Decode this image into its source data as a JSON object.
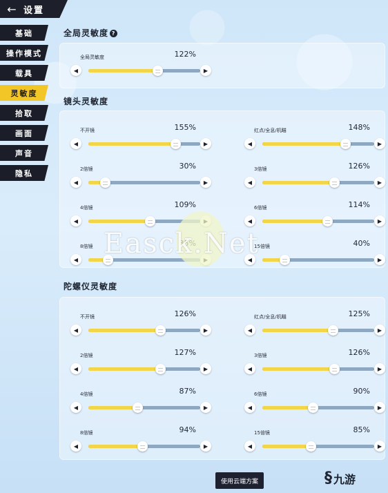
{
  "header": {
    "back_icon": "arrow-left-icon",
    "title": "设置"
  },
  "sidebar": {
    "items": [
      {
        "label": "基础",
        "active": false
      },
      {
        "label": "操作模式",
        "active": false
      },
      {
        "label": "载具",
        "active": false
      },
      {
        "label": "灵敏度",
        "active": true
      },
      {
        "label": "拾取",
        "active": false
      },
      {
        "label": "画面",
        "active": false
      },
      {
        "label": "声音",
        "active": false
      },
      {
        "label": "隐私",
        "active": false
      }
    ]
  },
  "global": {
    "title": "全局灵敏度",
    "info_icon": "?",
    "sliders": [
      {
        "label": "全局灵敏度",
        "value": "122%",
        "level": 0.62
      }
    ]
  },
  "scope": {
    "title": "镜头灵敏度",
    "left": [
      {
        "label": "不开镜",
        "value": "155%",
        "level": 0.78
      },
      {
        "label": "2倍镜",
        "value": "30%",
        "level": 0.15
      },
      {
        "label": "4倍镜",
        "value": "109%",
        "level": 0.55
      },
      {
        "label": "8倍镜",
        "value": "35%",
        "level": 0.17
      }
    ],
    "right": [
      {
        "label": "红点/全息/机瞄",
        "value": "148%",
        "level": 0.74
      },
      {
        "label": "3倍镜",
        "value": "126%",
        "level": 0.64
      },
      {
        "label": "6倍镜",
        "value": "114%",
        "level": 0.58
      },
      {
        "label": "15倍镜",
        "value": "40%",
        "level": 0.2
      }
    ]
  },
  "gyro": {
    "title": "陀螺仪灵敏度",
    "left": [
      {
        "label": "不开镜",
        "value": "126%",
        "level": 0.64
      },
      {
        "label": "2倍镜",
        "value": "127%",
        "level": 0.64
      },
      {
        "label": "4倍镜",
        "value": "87%",
        "level": 0.44
      },
      {
        "label": "8倍镜",
        "value": "94%",
        "level": 0.48
      }
    ],
    "right": [
      {
        "label": "红点/全息/机瞄",
        "value": "125%",
        "level": 0.63
      },
      {
        "label": "3倍镜",
        "value": "126%",
        "level": 0.64
      },
      {
        "label": "6倍镜",
        "value": "90%",
        "level": 0.45
      },
      {
        "label": "15倍镜",
        "value": "85%",
        "level": 0.43
      }
    ]
  },
  "footer": {
    "cloud_button": "使用云端方案"
  },
  "watermark": "Easck.Net",
  "brand": {
    "text": "九游"
  },
  "colors": {
    "accent": "#f3c628",
    "sidebar": "#1b1e29",
    "fill": "#f2d548",
    "track": "#8da8c0"
  }
}
